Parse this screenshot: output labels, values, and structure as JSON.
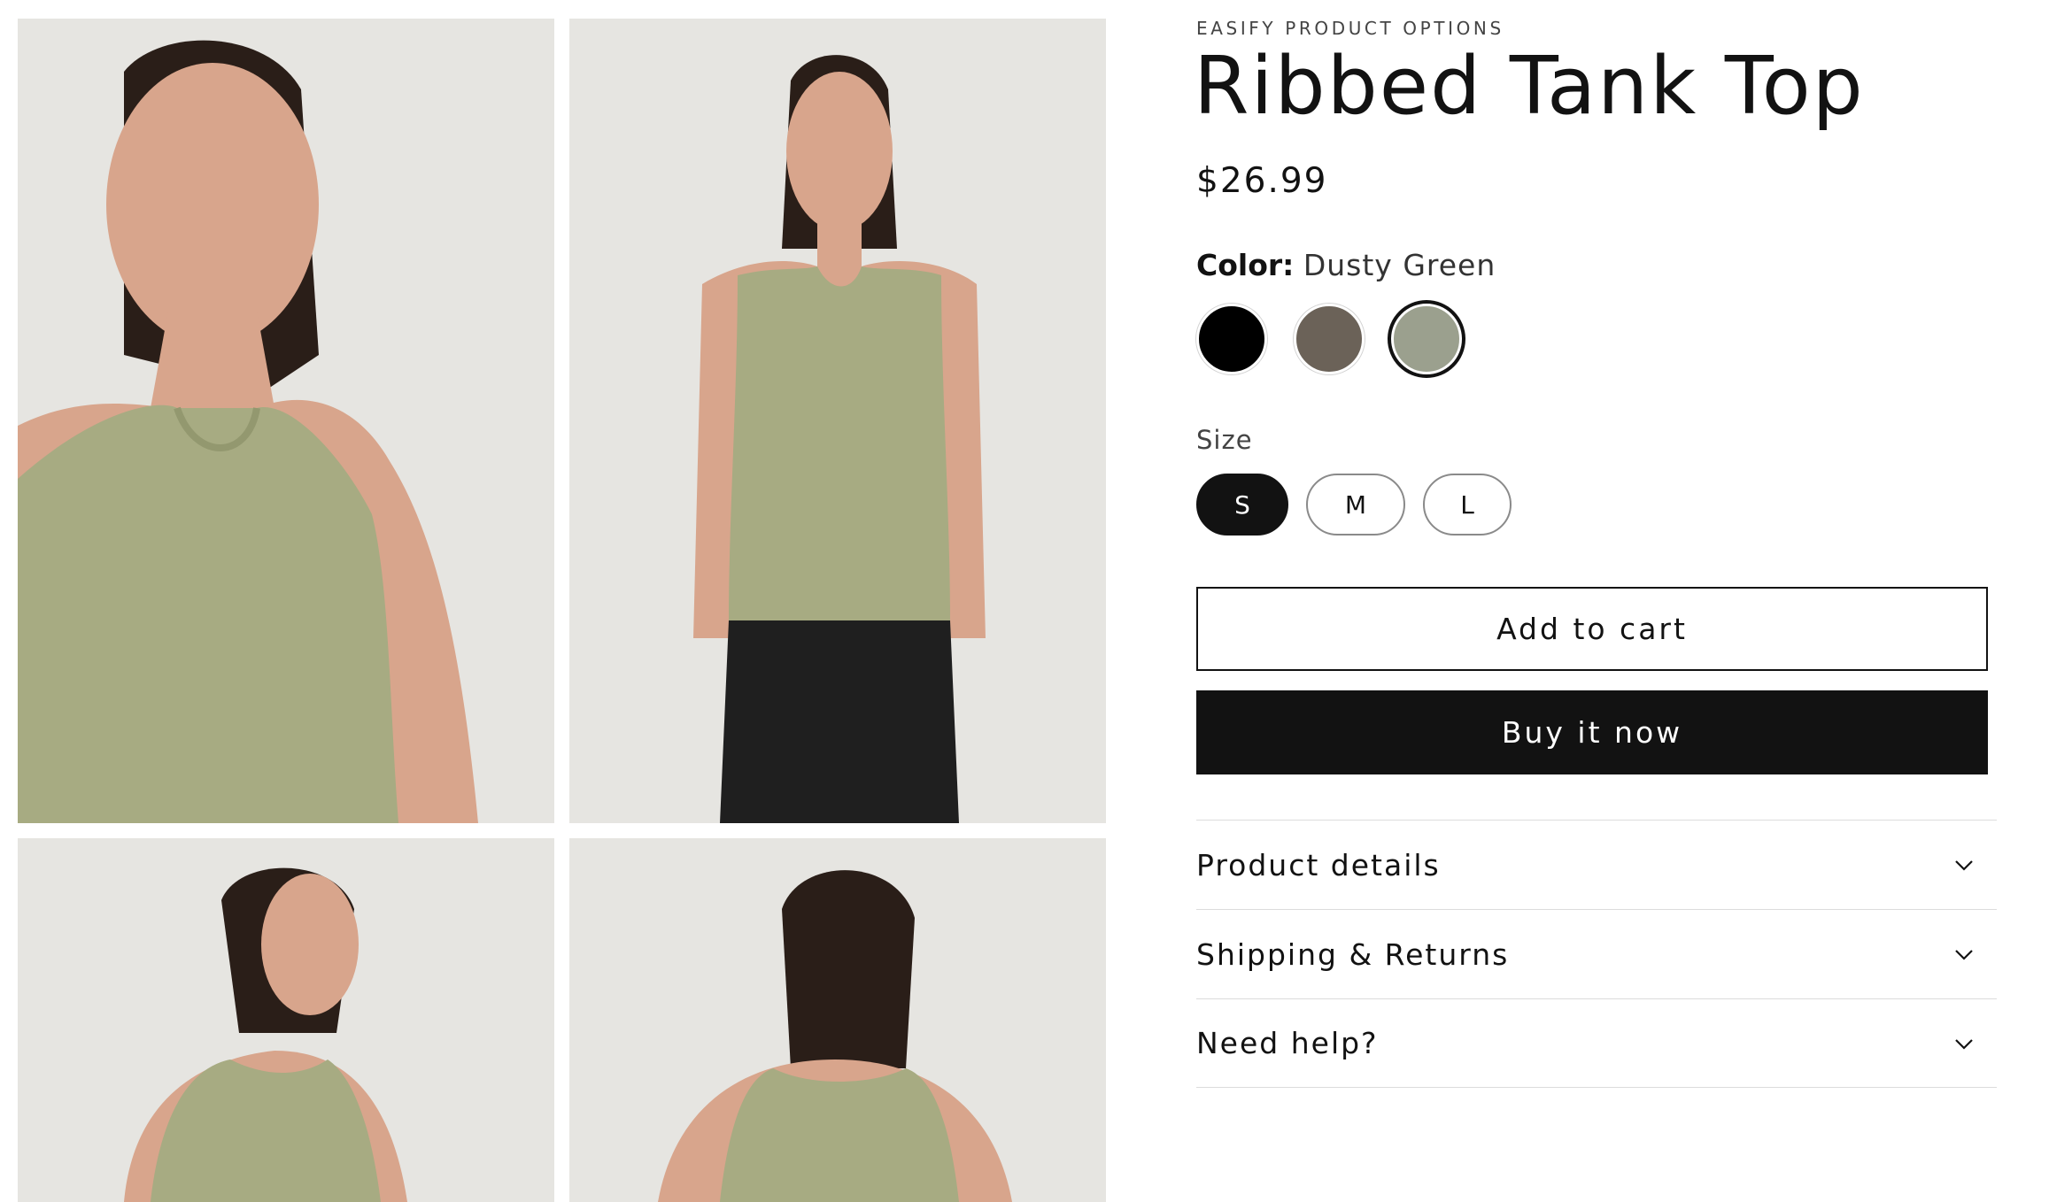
{
  "product": {
    "vendor": "EASIFY PRODUCT OPTIONS",
    "title": "Ribbed Tank Top",
    "price": "$26.99"
  },
  "color": {
    "label": "Color:",
    "selected_value": "Dusty Green",
    "swatches": [
      {
        "name": "Black",
        "hex": "#000000"
      },
      {
        "name": "Brown",
        "hex": "#6b6258"
      },
      {
        "name": "Dusty Green",
        "hex": "#9ba08e"
      }
    ]
  },
  "size": {
    "label": "Size",
    "options": [
      "S",
      "M",
      "L"
    ],
    "selected": "S"
  },
  "buttons": {
    "add_to_cart": "Add to cart",
    "buy_now": "Buy it now"
  },
  "accordion": [
    "Product details",
    "Shipping & Returns",
    "Need help?"
  ],
  "gallery": {
    "images": [
      "model-front-closeup",
      "model-full-front",
      "model-side-turn",
      "model-back"
    ],
    "colors": {
      "background": "#e6e5e1",
      "top": "#a7ab82",
      "skin": "#d8a58c",
      "hair": "#2a1e18",
      "pants": "#1f1f1f"
    }
  }
}
